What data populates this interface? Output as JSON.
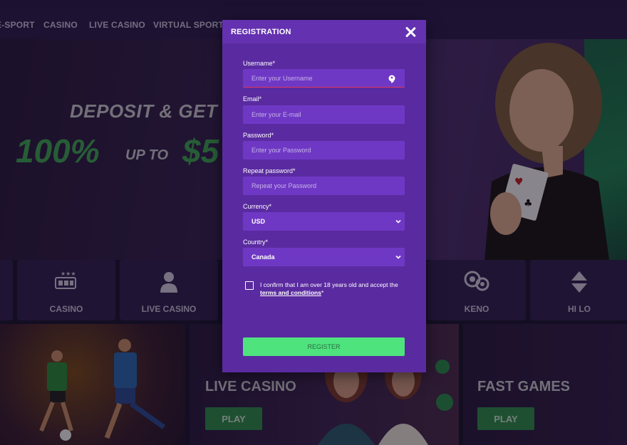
{
  "nav": {
    "items": [
      "E-SPORT",
      "CASINO",
      "LIVE CASINO",
      "VIRTUAL SPORT"
    ]
  },
  "hero": {
    "line1": "DEPOSIT & GET",
    "percent": "100%",
    "up_to": "UP TO",
    "amount": "$5"
  },
  "tiles": [
    {
      "label": "",
      "icon": "tile-icon"
    },
    {
      "label": "CASINO",
      "icon": "slot-machine-icon"
    },
    {
      "label": "LIVE CASINO",
      "icon": "dealer-icon"
    },
    {
      "label": "KENO",
      "icon": "keno-balls-icon"
    },
    {
      "label": "HI LO",
      "icon": "hi-lo-arrows-icon"
    }
  ],
  "promos": {
    "live_casino": {
      "title": "LIVE CASINO",
      "button": "PLAY"
    },
    "fast_games": {
      "title": "FAST GAMES",
      "button": "PLAY"
    }
  },
  "modal": {
    "title": "REGISTRATION",
    "username": {
      "label": "Username*",
      "placeholder": "Enter your Username"
    },
    "email": {
      "label": "Email*",
      "placeholder": "Enter your E-mail"
    },
    "password": {
      "label": "Password*",
      "placeholder": "Enter your Password"
    },
    "repeat_password": {
      "label": "Repeat password*",
      "placeholder": "Repeat your Password"
    },
    "currency": {
      "label": "Currency*",
      "value": "USD"
    },
    "country": {
      "label": "Country*",
      "value": "Canada"
    },
    "confirm_text": "I confirm that I am over 18 years old and accept the",
    "terms_link": "terms and conditions",
    "terms_suffix": "*",
    "register_button": "REGISTER"
  },
  "colors": {
    "modal_bg": "#5a2ba0",
    "field_bg": "#6f38c4",
    "register_bg": "#4fe37e",
    "accent_green": "#3fa553",
    "error_underline": "#e0375f"
  }
}
